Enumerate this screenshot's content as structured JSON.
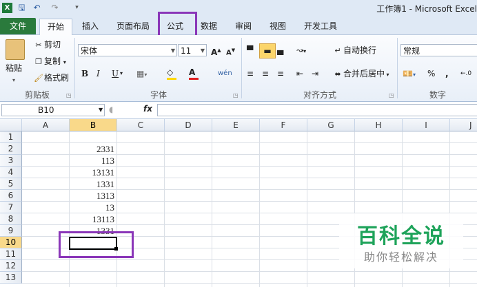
{
  "title_bar": {
    "window_title": "工作簿1 - Microsoft Excel",
    "quick_access_icons": [
      "excel-logo-icon",
      "save-icon",
      "undo-icon",
      "redo-icon",
      "customize-qat-icon"
    ]
  },
  "tabs": [
    {
      "label": "文件"
    },
    {
      "label": "开始"
    },
    {
      "label": "插入"
    },
    {
      "label": "页面布局"
    },
    {
      "label": "公式"
    },
    {
      "label": "数据"
    },
    {
      "label": "审阅"
    },
    {
      "label": "视图"
    },
    {
      "label": "开发工具"
    }
  ],
  "ribbon": {
    "clipboard": {
      "paste": "粘贴",
      "cut": "剪切",
      "copy": "复制",
      "format_painter": "格式刷",
      "group_label": "剪贴板"
    },
    "font": {
      "font_name": "宋体",
      "font_size": "11",
      "bold": "B",
      "italic": "I",
      "underline": "U",
      "group_label": "字体"
    },
    "alignment": {
      "wrap_text": "自动换行",
      "merge_center": "合并后居中",
      "group_label": "对齐方式"
    },
    "number": {
      "format": "常规",
      "percent": "%",
      "comma": ",",
      "group_label": "数字"
    }
  },
  "formula_bar": {
    "name_box": "B10",
    "fx": "fx",
    "content": ""
  },
  "sheet": {
    "columns": [
      "A",
      "B",
      "C",
      "D",
      "E",
      "F",
      "G",
      "H",
      "I",
      "J"
    ],
    "rows": [
      "1",
      "2",
      "3",
      "4",
      "5",
      "6",
      "7",
      "8",
      "9",
      "10",
      "11",
      "12",
      "13"
    ],
    "selected_cell": "B10",
    "column_b_values": [
      "",
      "2331",
      "113",
      "13131",
      "1331",
      "1313",
      "13",
      "13113",
      "1331",
      "",
      "",
      "",
      ""
    ]
  },
  "highlight_color": "#8a36b8",
  "watermark": {
    "title": "百科全说",
    "subtitle": "助你轻松解决"
  }
}
